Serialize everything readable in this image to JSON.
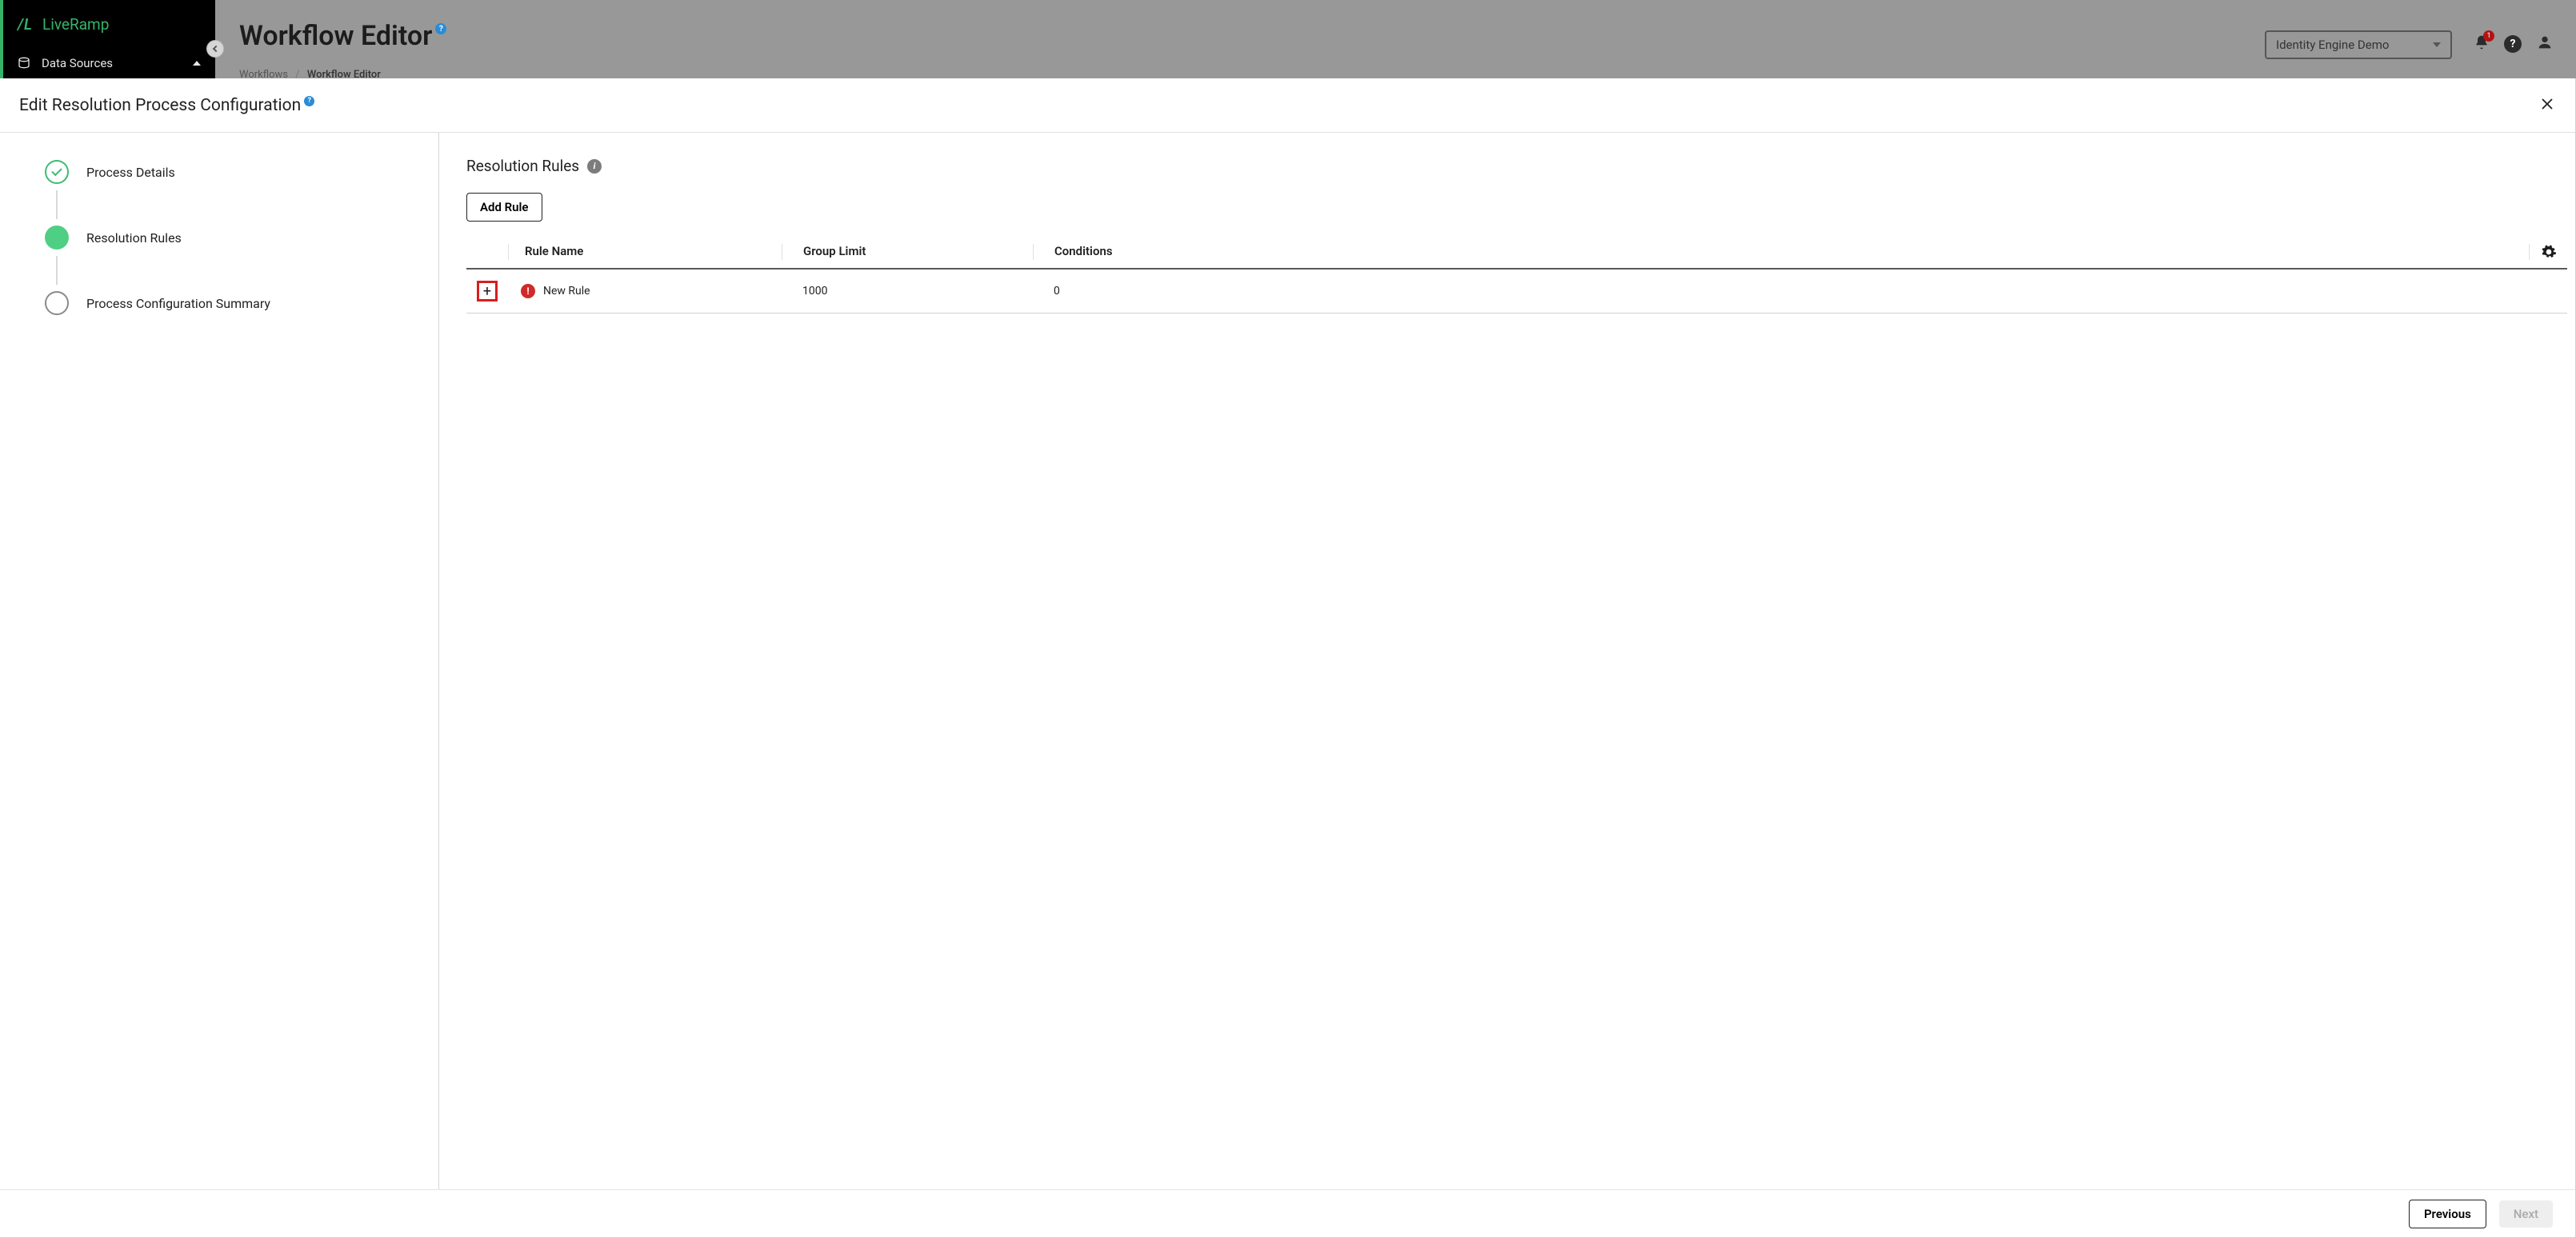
{
  "brand": {
    "name": "LiveRamp",
    "logo_text": "/L"
  },
  "sidebar": {
    "items": [
      {
        "label": "Data Sources"
      }
    ]
  },
  "header": {
    "title": "Workflow Editor",
    "tenant_selected": "Identity Engine Demo",
    "notification_count": "1",
    "breadcrumbs": {
      "parent": "Workflows",
      "current": "Workflow Editor"
    }
  },
  "modal": {
    "title": "Edit Resolution Process Configuration",
    "steps": [
      {
        "label": "Process Details",
        "state": "done"
      },
      {
        "label": "Resolution Rules",
        "state": "active"
      },
      {
        "label": "Process Configuration Summary",
        "state": "pending"
      }
    ],
    "section_title": "Resolution Rules",
    "add_rule_label": "Add Rule",
    "columns": {
      "name": "Rule Name",
      "group": "Group Limit",
      "cond": "Conditions"
    },
    "rows": [
      {
        "name": "New Rule",
        "group_limit": "1000",
        "conditions": "0",
        "has_warning": true
      }
    ],
    "footer": {
      "previous": "Previous",
      "next": "Next"
    }
  }
}
